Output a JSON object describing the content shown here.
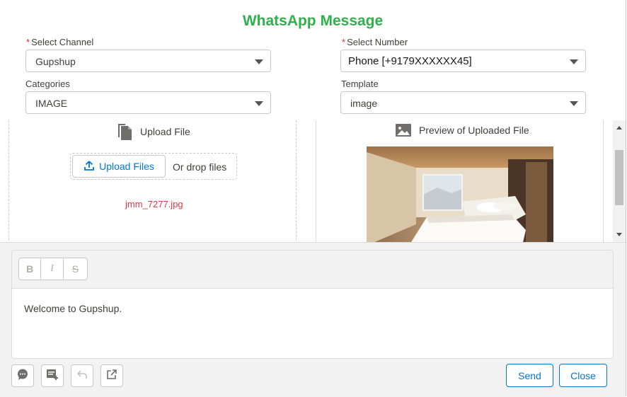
{
  "modal": {
    "title": "WhatsApp Message"
  },
  "form": {
    "channel": {
      "label": "Select Channel",
      "required_mark": "*",
      "value": "Gupshup"
    },
    "number": {
      "label": "Select Number",
      "required_mark": "*",
      "value": "Phone [+9179XXXXXX45]"
    },
    "categories": {
      "label": "Categories",
      "value": "IMAGE"
    },
    "template": {
      "label": "Template",
      "value": "image"
    }
  },
  "upload": {
    "heading": "Upload File",
    "button_label": "Upload Files",
    "drop_text": "Or drop files",
    "filename": "jmm_7277.jpg",
    "icon": "document-icon"
  },
  "preview": {
    "heading": "Preview of Uploaded File",
    "icon": "image-icon"
  },
  "editor": {
    "toolbar": {
      "bold": "B",
      "italic": "I",
      "strike": "S"
    },
    "text": "Welcome to Gupshup."
  },
  "footer": {
    "send_label": "Send",
    "close_label": "Close",
    "icons": [
      "chat-icon",
      "add-note-icon",
      "undo-icon",
      "open-external-icon"
    ]
  },
  "colors": {
    "title": "#2eb14a",
    "accent": "#0176d3",
    "filename": "#e0344b",
    "required": "#c23934"
  }
}
